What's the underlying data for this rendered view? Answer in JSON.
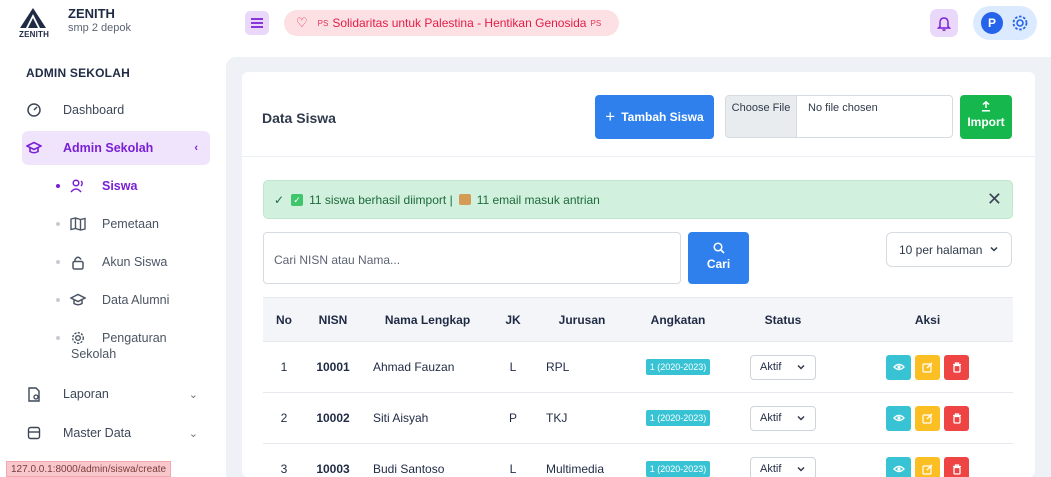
{
  "brand": {
    "name": "ZENITH",
    "logo_text": "ZENITH",
    "school": "smp 2 depok"
  },
  "sidebar": {
    "section_title": "ADMIN SEKOLAH",
    "dashboard": "Dashboard",
    "admin_sekolah": "Admin Sekolah",
    "sub": {
      "siswa": "Siswa",
      "pemetaan": "Pemetaan",
      "akun_siswa": "Akun Siswa",
      "data_alumni": "Data Alumni",
      "pengaturan_1": "Pengaturan",
      "pengaturan_2": "Sekolah"
    },
    "laporan": "Laporan",
    "master_data": "Master Data"
  },
  "statusbar": "127.0.0.1:8000/admin/siswa/create",
  "topbar": {
    "announcement": "Solidaritas untuk Palestina - Hentikan Genosida",
    "flag_tag": "PS",
    "avatar_initial": "P"
  },
  "page": {
    "title": "Data Siswa",
    "add_button": "Tambah Siswa",
    "file_button": "Choose File",
    "file_status": "No file chosen",
    "import_button": "Import",
    "alert_text_1": "11 siswa berhasil diimport |",
    "alert_text_2": "11 email masuk antrian",
    "search_placeholder": "Cari NISN atau Nama...",
    "search_button": "Cari",
    "per_page": "10 per halaman"
  },
  "table": {
    "headers": {
      "no": "No",
      "nisn": "NISN",
      "nama": "Nama Lengkap",
      "jk": "JK",
      "jurusan": "Jurusan",
      "angkatan": "Angkatan",
      "status": "Status",
      "aksi": "Aksi"
    },
    "rows": [
      {
        "no": "1",
        "nisn": "10001",
        "nama": "Ahmad Fauzan",
        "jk": "L",
        "jurusan": "RPL",
        "angkatan": "1 (2020-2023)",
        "status": "Aktif"
      },
      {
        "no": "2",
        "nisn": "10002",
        "nama": "Siti Aisyah",
        "jk": "P",
        "jurusan": "TKJ",
        "angkatan": "1 (2020-2023)",
        "status": "Aktif"
      },
      {
        "no": "3",
        "nisn": "10003",
        "nama": "Budi Santoso",
        "jk": "L",
        "jurusan": "Multimedia",
        "angkatan": "1 (2020-2023)",
        "status": "Aktif"
      }
    ]
  },
  "colors": {
    "accent": "#7a1fd6",
    "primary": "#2f80ed",
    "success": "#16b84e",
    "danger": "#ef4444",
    "warning": "#fbbf24",
    "info": "#38c3d5"
  }
}
